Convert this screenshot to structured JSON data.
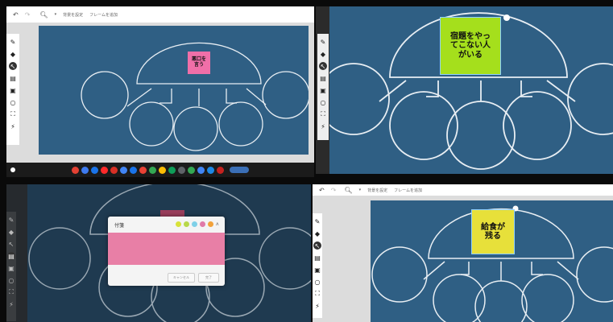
{
  "toolbar": {
    "undo_icon": "undo-icon",
    "redo_icon": "redo-icon",
    "zoom_icon": "zoom-icon",
    "background_label": "背景を設定",
    "frame_label": "フレームを追加"
  },
  "panels": {
    "top_left": {
      "sticky_text": "悪口を\n言う",
      "sticky_color": "#f06fa8"
    },
    "top_right": {
      "sticky_text": "宿題をやっ\nてこない人\nがいる",
      "sticky_color": "#a5df1c"
    },
    "bottom_left": {
      "dialog_title": "付箋",
      "swatch_colors": [
        "#d8e23a",
        "#b8d84a",
        "#7fd0e8",
        "#e07aa8",
        "#f2a23a"
      ],
      "cancel_label": "キャンセル",
      "ok_label": "完了",
      "sticky_color": "#e87fa6"
    },
    "bottom_right": {
      "sticky_text": "給食が\n残る",
      "sticky_color": "#e7e03a"
    }
  },
  "colors": {
    "canvas": "#2f5f84",
    "stroke": "#e8eef3"
  },
  "taskbar_icons": [
    "launcher",
    "chrome",
    "files",
    "meet",
    "youtube",
    "gmail",
    "calendar",
    "docs",
    "camera",
    "photos",
    "drive",
    "classroom",
    "settings",
    "app",
    "play",
    "status"
  ]
}
